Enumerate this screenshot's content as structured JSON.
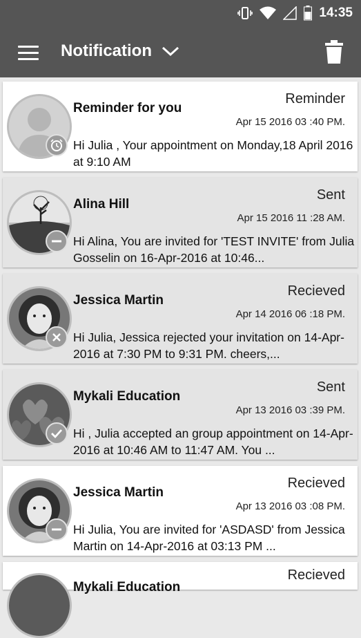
{
  "status_bar": {
    "time": "14:35",
    "icons": [
      "vibrate-icon",
      "wifi-icon",
      "signal-icon",
      "battery-icon"
    ]
  },
  "app_bar": {
    "title": "Notification",
    "menu_icon": "hamburger-menu-icon",
    "dropdown_icon": "chevron-down-icon",
    "delete_icon": "trash-icon"
  },
  "colors": {
    "header": "#555555",
    "card_unread": "#ffffff",
    "card_read": "#e4e4e4",
    "badge": "#9a9a9a"
  },
  "notifications": [
    {
      "name": "Reminder for you",
      "type": "Reminder",
      "date": "Apr 15 2016 03 :40 PM.",
      "message": "Hi Julia , Your appointment on Monday,18 April 2016 at 9:10 AM",
      "avatar": "default-person-avatar",
      "badge_icon": "alarm-clock-icon",
      "read": false
    },
    {
      "name": "Alina Hill",
      "type": "Sent",
      "date": "Apr 15 2016 11 :28 AM.",
      "message": "Hi Alina, You are invited for 'TEST INVITE' from Julia Gosselin on 16-Apr-2016 at 10:46...",
      "avatar": "landscape-tree-avatar",
      "badge_icon": "minus-icon",
      "read": true
    },
    {
      "name": "Jessica Martin",
      "type": "Recieved",
      "date": "Apr 14 2016 06 :18 PM.",
      "message": "Hi Julia, Jessica rejected your invitation on 14-Apr-2016 at 7:30 PM to 9:31 PM. cheers,...",
      "avatar": "child-photo-avatar",
      "badge_icon": "x-icon",
      "read": true
    },
    {
      "name": "Mykali Education",
      "type": "Sent",
      "date": "Apr 13 2016 03 :39 PM.",
      "message": "Hi , Julia accepted an group appointment on 14-Apr-2016 at 10:46 AM to 11:47 AM. You ...",
      "avatar": "hearts-avatar",
      "badge_icon": "check-icon",
      "read": true
    },
    {
      "name": "Jessica Martin",
      "type": "Recieved",
      "date": "Apr 13 2016 03 :08 PM.",
      "message": "Hi Julia, You are invited for 'ASDASD' from Jessica Martin on 14-Apr-2016 at 03:13 PM ...",
      "avatar": "child-photo-avatar",
      "badge_icon": "minus-icon",
      "read": false
    },
    {
      "name": "Mykali Education",
      "type": "Recieved",
      "read": false
    }
  ]
}
